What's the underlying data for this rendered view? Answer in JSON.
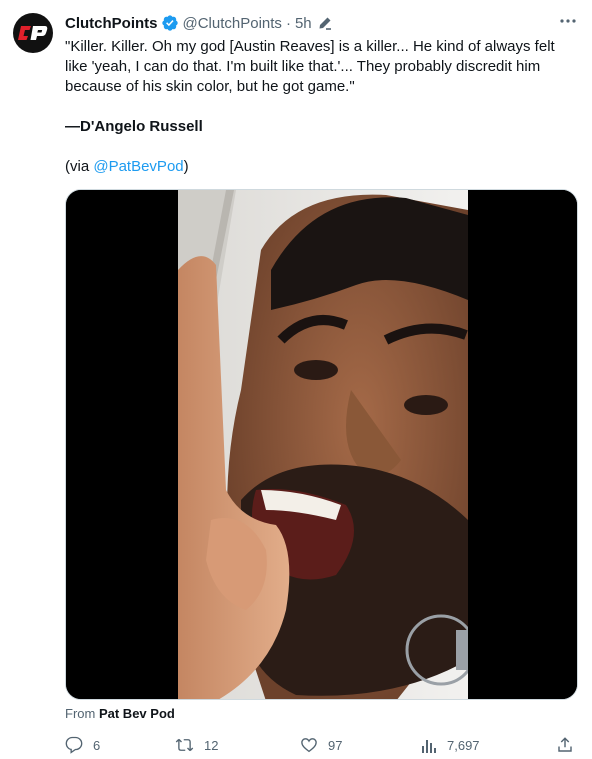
{
  "author": {
    "name": "ClutchPoints",
    "handle": "@ClutchPoints",
    "separator": "·",
    "time": "5h",
    "avatar_text": "CP"
  },
  "tweet": {
    "quote": "\"Killer. Killer. Oh my god [Austin Reaves] is a killer... He kind of always felt like 'yeah, I can do that. I'm built  like that.'... They probably discredit him because of his skin color, but he got game.\"",
    "attribution": "—D'Angelo Russell",
    "via_prefix": "(via ",
    "via_link": "@PatBevPod",
    "via_suffix": ")"
  },
  "media": {
    "source_prefix": "From",
    "source_name": "Pat Bev Pod"
  },
  "actions": {
    "replies": "6",
    "retweets": "12",
    "likes": "97",
    "views": "7,697"
  },
  "colors": {
    "accent": "#1d9bf0",
    "secondary_text": "#536471",
    "brand_red": "#e0202b"
  },
  "icons": [
    "verified-badge-icon",
    "edit-icon",
    "more-icon",
    "reply-icon",
    "retweet-icon",
    "like-icon",
    "views-icon",
    "share-icon"
  ]
}
